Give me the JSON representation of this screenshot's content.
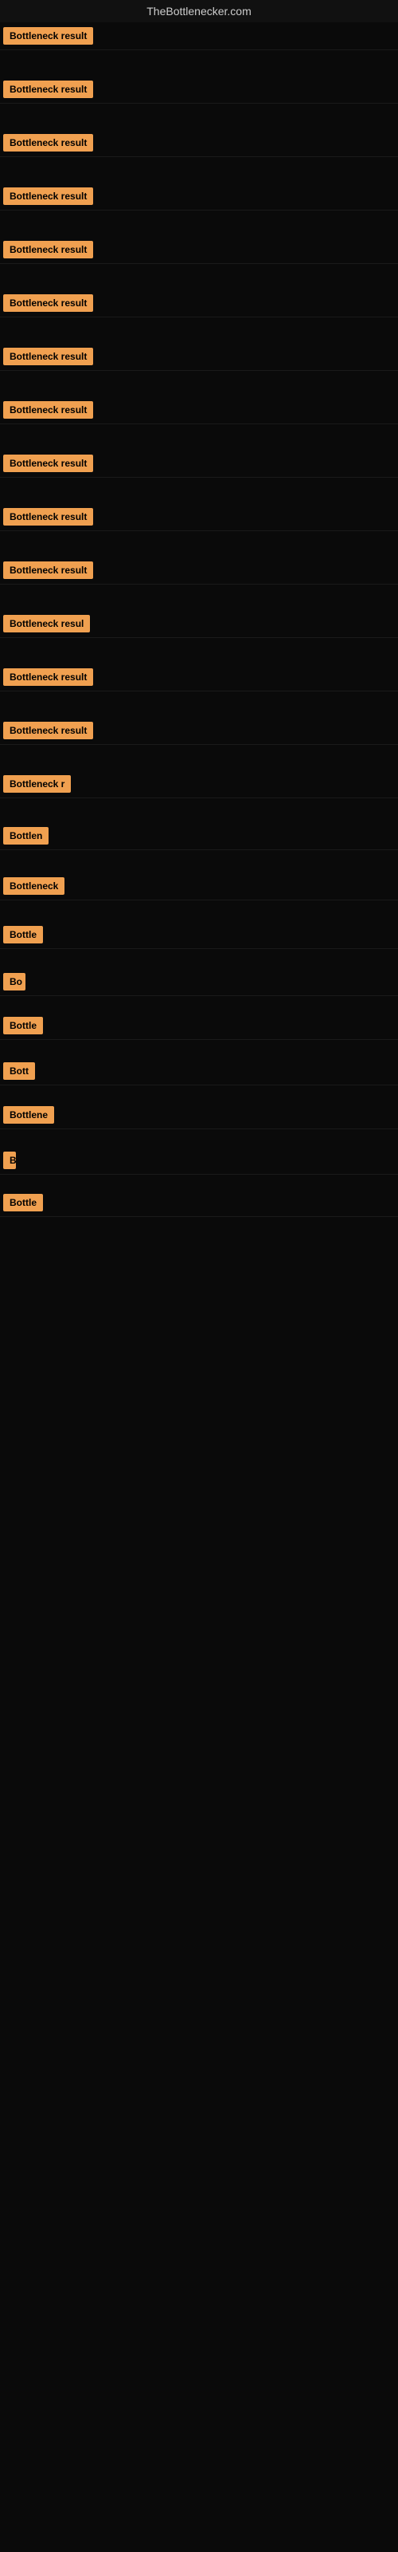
{
  "site": {
    "title": "TheBottlenecker.com"
  },
  "results": [
    {
      "id": 1,
      "label": "Bottleneck result",
      "width": 155
    },
    {
      "id": 2,
      "label": "Bottleneck result",
      "width": 155
    },
    {
      "id": 3,
      "label": "Bottleneck result",
      "width": 155
    },
    {
      "id": 4,
      "label": "Bottleneck result",
      "width": 155
    },
    {
      "id": 5,
      "label": "Bottleneck result",
      "width": 155
    },
    {
      "id": 6,
      "label": "Bottleneck result",
      "width": 155
    },
    {
      "id": 7,
      "label": "Bottleneck result",
      "width": 155
    },
    {
      "id": 8,
      "label": "Bottleneck result",
      "width": 155
    },
    {
      "id": 9,
      "label": "Bottleneck result",
      "width": 155
    },
    {
      "id": 10,
      "label": "Bottleneck result",
      "width": 155
    },
    {
      "id": 11,
      "label": "Bottleneck result",
      "width": 155
    },
    {
      "id": 12,
      "label": "Bottleneck resul",
      "width": 140
    },
    {
      "id": 13,
      "label": "Bottleneck result",
      "width": 145
    },
    {
      "id": 14,
      "label": "Bottleneck result",
      "width": 140
    },
    {
      "id": 15,
      "label": "Bottleneck r",
      "width": 100
    },
    {
      "id": 16,
      "label": "Bottlen",
      "width": 72
    },
    {
      "id": 17,
      "label": "Bottleneck",
      "width": 85
    },
    {
      "id": 18,
      "label": "Bottle",
      "width": 60
    },
    {
      "id": 19,
      "label": "Bo",
      "width": 28
    },
    {
      "id": 20,
      "label": "Bottle",
      "width": 60
    },
    {
      "id": 21,
      "label": "Bott",
      "width": 40
    },
    {
      "id": 22,
      "label": "Bottlene",
      "width": 70
    },
    {
      "id": 23,
      "label": "B",
      "width": 16
    },
    {
      "id": 24,
      "label": "Bottle",
      "width": 58
    }
  ]
}
